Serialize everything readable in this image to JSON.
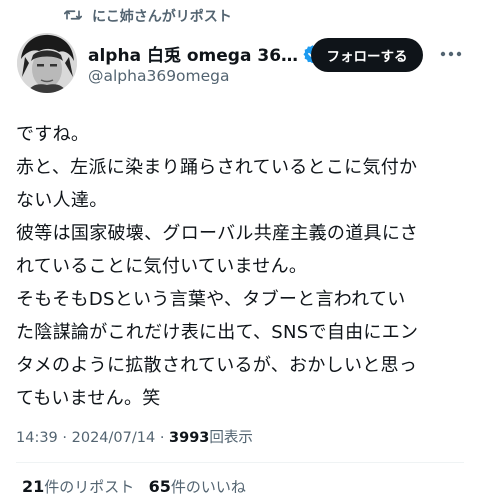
{
  "repost": {
    "text": "にこ姉さんがリポスト",
    "icon": "repost-icon"
  },
  "author": {
    "display_name": "alpha 白兎 omega 36…",
    "handle": "@alpha369omega",
    "verified": true,
    "verified_color": "#1d9bf0"
  },
  "follow_label": "フォローする",
  "tweet": {
    "lines": [
      "ですね。",
      "赤と、左派に染まり踊らされているとこに気付か",
      "ない人達。",
      "彼等は国家破壊、グローバル共産主義の道具にさ",
      "れていることに気付いていません。",
      "そもそもDSという言葉や、タブーと言われてい",
      "た陰謀論がこれだけ表に出て、SNSで自由にエン",
      "タメのように拡散されているが、おかしいと思っ",
      "てもいません。笑"
    ]
  },
  "meta": {
    "time": "14:39",
    "separator": "·",
    "date": "2024/07/14",
    "views_count": "3993",
    "views_label": "回表示"
  },
  "stats": {
    "reposts_count": "21",
    "reposts_label": "件のリポスト",
    "likes_count": "65",
    "likes_label": "件のいいね"
  }
}
